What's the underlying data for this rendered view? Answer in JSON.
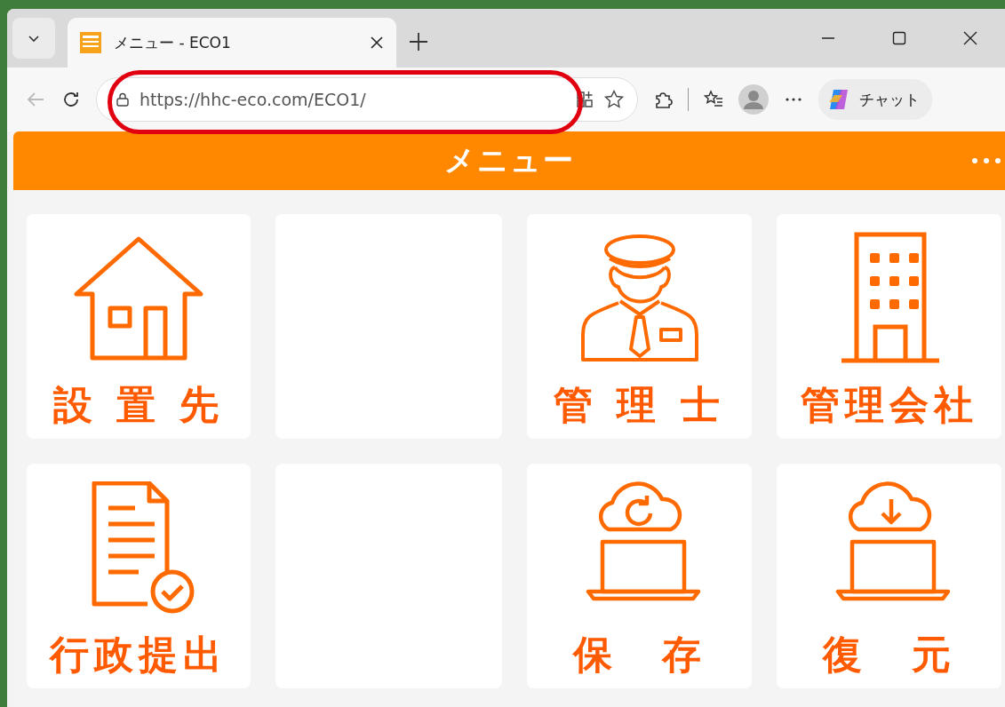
{
  "browser": {
    "tab": {
      "title": "メニュー - ECO1"
    },
    "address": "https://hhc-eco.com/ECO1/",
    "chat_button": "チャット"
  },
  "header": {
    "title": "メニュー"
  },
  "tiles": [
    {
      "kind": "house",
      "label": "設 置 先"
    },
    {
      "kind": "empty"
    },
    {
      "kind": "officer",
      "label": "管 理 士"
    },
    {
      "kind": "building",
      "label": "管理会社"
    },
    {
      "kind": "document",
      "label": "行政提出"
    },
    {
      "kind": "empty"
    },
    {
      "kind": "cloud-sync",
      "label": "保　存"
    },
    {
      "kind": "cloud-download",
      "label": "復　元"
    }
  ]
}
